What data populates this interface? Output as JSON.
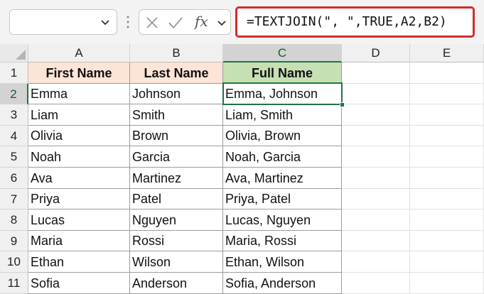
{
  "formula_bar": {
    "name_box_value": "",
    "fx_label": "fx",
    "formula": "=TEXTJOIN(\", \",TRUE,A2,B2)"
  },
  "columns": [
    "A",
    "B",
    "C",
    "D",
    "E"
  ],
  "rows": [
    "1",
    "2",
    "3",
    "4",
    "5",
    "6",
    "7",
    "8",
    "9",
    "10",
    "11"
  ],
  "headers": {
    "first_name": "First Name",
    "last_name": "Last Name",
    "full_name": "Full Name"
  },
  "table": [
    {
      "first": "Emma",
      "last": "Johnson",
      "full": "Emma, Johnson"
    },
    {
      "first": "Liam",
      "last": "Smith",
      "full": "Liam, Smith"
    },
    {
      "first": "Olivia",
      "last": "Brown",
      "full": "Olivia, Brown"
    },
    {
      "first": "Noah",
      "last": "Garcia",
      "full": "Noah, Garcia"
    },
    {
      "first": "Ava",
      "last": "Martinez",
      "full": "Ava, Martinez"
    },
    {
      "first": "Priya",
      "last": "Patel",
      "full": "Priya, Patel"
    },
    {
      "first": "Lucas",
      "last": "Nguyen",
      "full": "Lucas, Nguyen"
    },
    {
      "first": "Maria",
      "last": "Rossi",
      "full": "Maria, Rossi"
    },
    {
      "first": "Ethan",
      "last": "Wilson",
      "full": "Ethan, Wilson"
    },
    {
      "first": "Sofia",
      "last": "Anderson",
      "full": "Sofia, Anderson"
    }
  ],
  "selection": {
    "column": "C",
    "row": "2"
  },
  "colors": {
    "accent": "#217346",
    "formula_highlight": "#d42b2b",
    "header_orange": "#fce4d6",
    "header_green": "#c6e0b4"
  },
  "icons": [
    "chevron-down-icon",
    "cancel-x-icon",
    "confirm-check-icon",
    "fx-icon",
    "select-all-icon"
  ]
}
